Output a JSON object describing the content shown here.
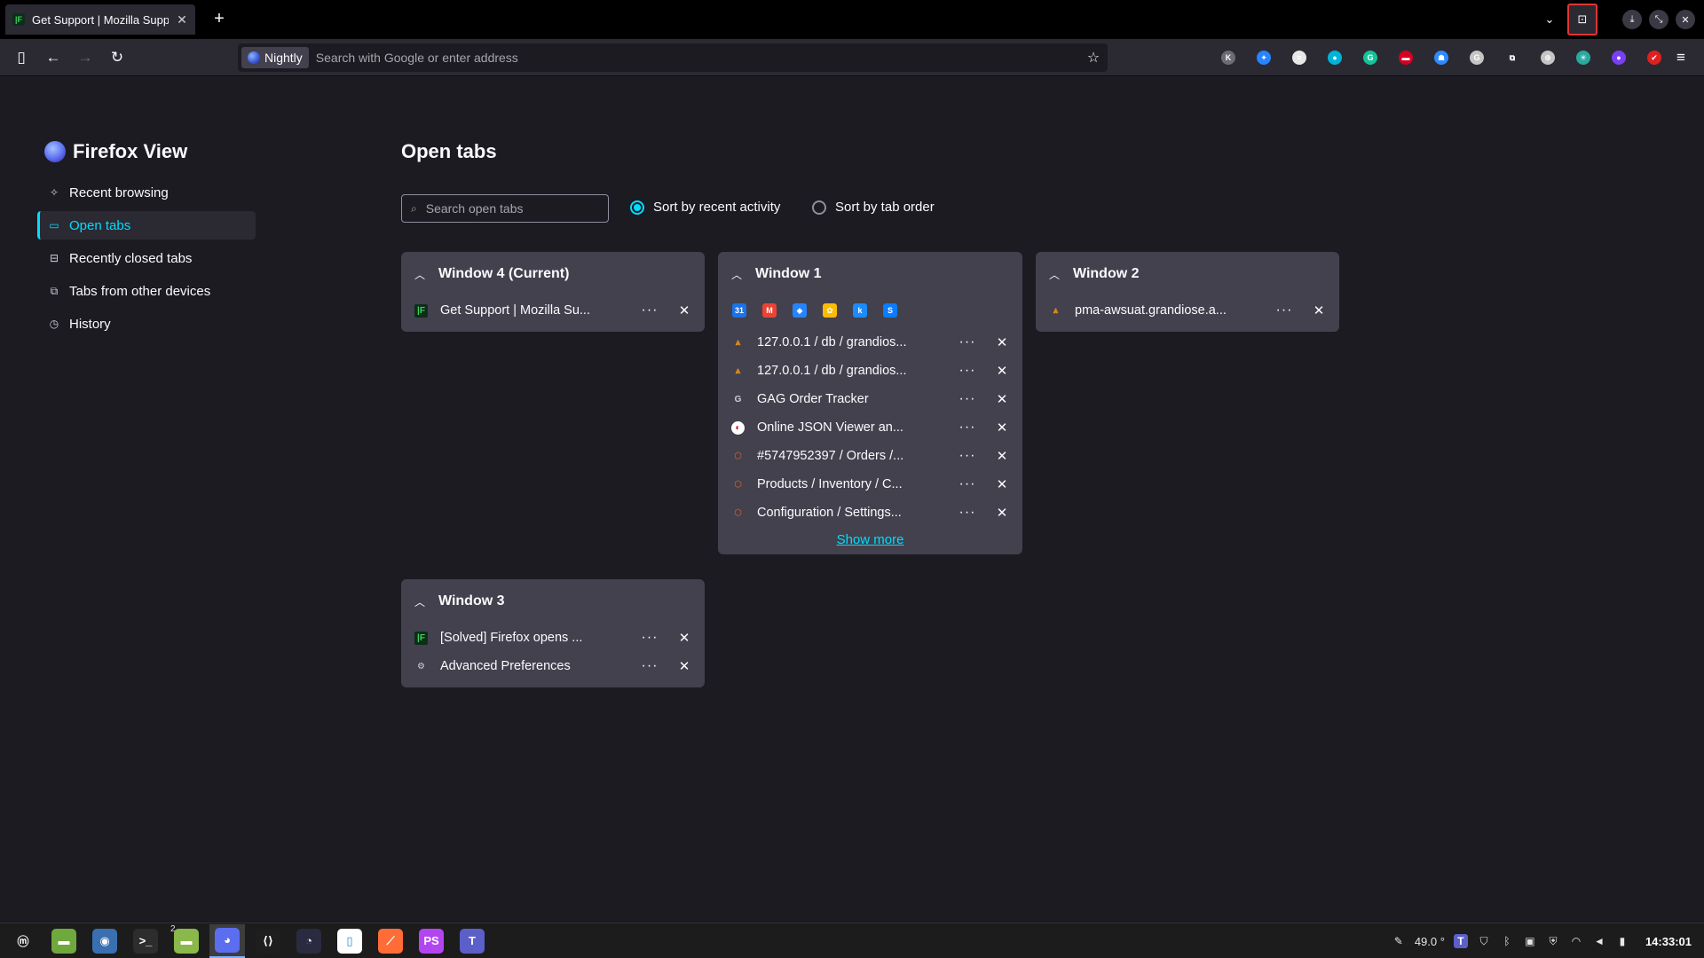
{
  "browser": {
    "active_tab_title": "Get Support | Mozilla Support",
    "identity_label": "Nightly",
    "url_placeholder": "Search with Google or enter address",
    "extensions": [
      {
        "icon": "k-circle-icon",
        "color": "#6b6b73",
        "glyph": "K"
      },
      {
        "icon": "jira-icon",
        "color": "#2684ff",
        "glyph": "✦"
      },
      {
        "icon": "chat-bubble-icon",
        "color": "#e8e8e8",
        "glyph": "≡"
      },
      {
        "icon": "cyan-square-icon",
        "color": "#00b4d8",
        "glyph": "●"
      },
      {
        "icon": "grammarly-icon",
        "color": "#15c39a",
        "glyph": "G"
      },
      {
        "icon": "red-box-icon",
        "color": "#d70022",
        "glyph": "▬"
      },
      {
        "icon": "ghost-icon",
        "color": "#2e8bff",
        "glyph": "☗"
      },
      {
        "icon": "shield-g-icon",
        "color": "#c5c5c5",
        "glyph": "G"
      },
      {
        "icon": "puzzle-icon",
        "color": "#2b2a33",
        "glyph": "⧉"
      },
      {
        "icon": "globe-icon",
        "color": "#c5c5c5",
        "glyph": "⊕"
      },
      {
        "icon": "sparkle-icon",
        "color": "#2aa9a0",
        "glyph": "✳"
      },
      {
        "icon": "purple-icon",
        "color": "#7a3ff2",
        "glyph": "●"
      },
      {
        "icon": "red-dot-icon",
        "color": "#e02020",
        "glyph": "✔"
      }
    ]
  },
  "sidebar": {
    "title": "Firefox View",
    "items": [
      {
        "label": "Recent browsing",
        "icon": "sparkle-icon",
        "glyph": "✧",
        "active": false
      },
      {
        "label": "Open tabs",
        "icon": "tabs-icon",
        "glyph": "▭",
        "active": true
      },
      {
        "label": "Recently closed tabs",
        "icon": "closed-tabs-icon",
        "glyph": "⊟",
        "active": false
      },
      {
        "label": "Tabs from other devices",
        "icon": "devices-icon",
        "glyph": "⧉",
        "active": false
      },
      {
        "label": "History",
        "icon": "clock-icon",
        "glyph": "◷",
        "active": false
      }
    ]
  },
  "main": {
    "heading": "Open tabs",
    "search_placeholder": "Search open tabs",
    "sort_recent": "Sort by recent activity",
    "sort_order": "Sort by tab order",
    "show_more": "Show more"
  },
  "windows": {
    "w4": {
      "title": "Window 4 (Current)",
      "tabs": [
        {
          "title": "Get Support | Mozilla Su...",
          "fav": "#0d2e1a",
          "fav_fg": "#3fd15e",
          "glyph": "|F"
        }
      ]
    },
    "w1": {
      "title": "Window 1",
      "pinned": [
        {
          "icon": "calendar-icon",
          "color": "#1a73e8",
          "glyph": "31"
        },
        {
          "icon": "gmail-icon",
          "color": "#ea4335",
          "glyph": "M"
        },
        {
          "icon": "jira-icon",
          "color": "#2684ff",
          "glyph": "◆"
        },
        {
          "icon": "photos-icon",
          "color": "#fbbc04",
          "glyph": "✿"
        },
        {
          "icon": "k-icon",
          "color": "#1a8cff",
          "glyph": "k"
        },
        {
          "icon": "s-icon",
          "color": "#0a7cff",
          "glyph": "S"
        }
      ],
      "tabs": [
        {
          "title": "127.0.0.1 / db / grandios...",
          "fav": "transparent",
          "fav_fg": "#f29111",
          "glyph": "⩓"
        },
        {
          "title": "127.0.0.1 / db / grandios...",
          "fav": "transparent",
          "fav_fg": "#f29111",
          "glyph": "⩓"
        },
        {
          "title": "GAG Order Tracker",
          "fav": "transparent",
          "fav_fg": "#cfcfd8",
          "glyph": "G"
        },
        {
          "title": "Online JSON Viewer an...",
          "fav": "#ffffff",
          "fav_fg": "#d70022",
          "glyph": "◐"
        },
        {
          "title": "#5747952397 / Orders /...",
          "fav": "transparent",
          "fav_fg": "#f26322",
          "glyph": "⬡"
        },
        {
          "title": "Products / Inventory / C...",
          "fav": "transparent",
          "fav_fg": "#f26322",
          "glyph": "⬡"
        },
        {
          "title": "Configuration / Settings...",
          "fav": "transparent",
          "fav_fg": "#f26322",
          "glyph": "⬡"
        }
      ]
    },
    "w2": {
      "title": "Window 2",
      "tabs": [
        {
          "title": "pma-awsuat.grandiose.a...",
          "fav": "transparent",
          "fav_fg": "#f29111",
          "glyph": "⩓"
        }
      ]
    },
    "w3": {
      "title": "Window 3",
      "tabs": [
        {
          "title": "[Solved] Firefox opens ...",
          "fav": "#0d2e1a",
          "fav_fg": "#3fd15e",
          "glyph": "|F"
        },
        {
          "title": "Advanced Preferences",
          "fav": "transparent",
          "fav_fg": "#cfcfd8",
          "glyph": "⚙"
        }
      ]
    }
  },
  "taskbar": {
    "apps": [
      {
        "name": "mint-menu",
        "color": "#1c1c1c",
        "glyph": "ⓜ",
        "active": false
      },
      {
        "name": "files-green",
        "color": "#6fa83c",
        "glyph": "▬",
        "active": false
      },
      {
        "name": "screenshot",
        "color": "#3a6fb0",
        "glyph": "◉",
        "active": false
      },
      {
        "name": "terminal",
        "color": "#2d2d2d",
        "glyph": ">_",
        "active": false
      },
      {
        "name": "file-manager",
        "color": "#8bb84a",
        "glyph": "▬",
        "active": false
      },
      {
        "name": "firefox-nightly",
        "color": "#5b6ef0",
        "glyph": "◕",
        "active": true
      },
      {
        "name": "vscode",
        "color": "#1e1e1e",
        "glyph": "⟨⟩",
        "active": false
      },
      {
        "name": "dbeaver",
        "color": "#2a2a40",
        "glyph": "◔",
        "active": false
      },
      {
        "name": "libreoffice",
        "color": "#ffffff",
        "glyph": "▯",
        "active": false
      },
      {
        "name": "postman",
        "color": "#ff6c37",
        "glyph": "⟋",
        "active": false
      },
      {
        "name": "phpstorm",
        "color": "#b345f1",
        "glyph": "PS",
        "active": false
      },
      {
        "name": "teams",
        "color": "#5b5fc7",
        "glyph": "T",
        "active": false
      }
    ],
    "workspace_count": "2",
    "temperature": "49.0 °",
    "clock": "14:33:01"
  }
}
